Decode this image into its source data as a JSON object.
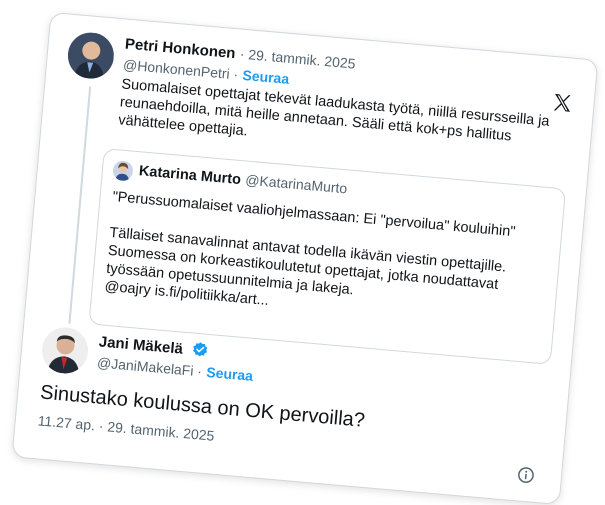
{
  "tweet": {
    "author_name": "Petri Honkonen",
    "date": "· 29. tammik. 2025",
    "handle": "@HonkonenPetri ·",
    "follow_label": "Seuraa",
    "text_lines": [
      "Suomalaiset opettajat tekevät laadukasta työtä, niillä resursseilla ja",
      "reunaehdoilla, mitä heille annetaan. Sääli että kok+ps hallitus",
      "vähättelee opettajia."
    ]
  },
  "quote": {
    "author_name": "Katarina Murto",
    "handle": "@KatarinaMurto",
    "line1": "\"Perussuomalaiset vaaliohjelmassaan: Ei \"pervoilua\" kouluihin\"",
    "text_lines": [
      "Tällaiset sanavalinnat antavat todella ikävän viestin opettajille.",
      "Suomessa on korkeastikoulutetut opettajat, jotka noudattavat",
      "työssään opetussuunnitelmia ja lakeja.",
      "@oajry is.fi/politiikka/art..."
    ]
  },
  "reply": {
    "author_name": "Jani Mäkelä",
    "handle": "@JaniMakelaFi ·",
    "follow_label": "Seuraa",
    "text": "Sinustako koulussa on OK pervoilla?",
    "timestamp": "11.27 ap. · 29. tammik. 2025"
  },
  "icons": {
    "x_logo": "x-logo-icon",
    "verified": "verified-badge-icon",
    "info": "info-icon"
  },
  "colors": {
    "accent": "#1d9bf0",
    "muted": "#536471",
    "border": "#cfd9de"
  }
}
